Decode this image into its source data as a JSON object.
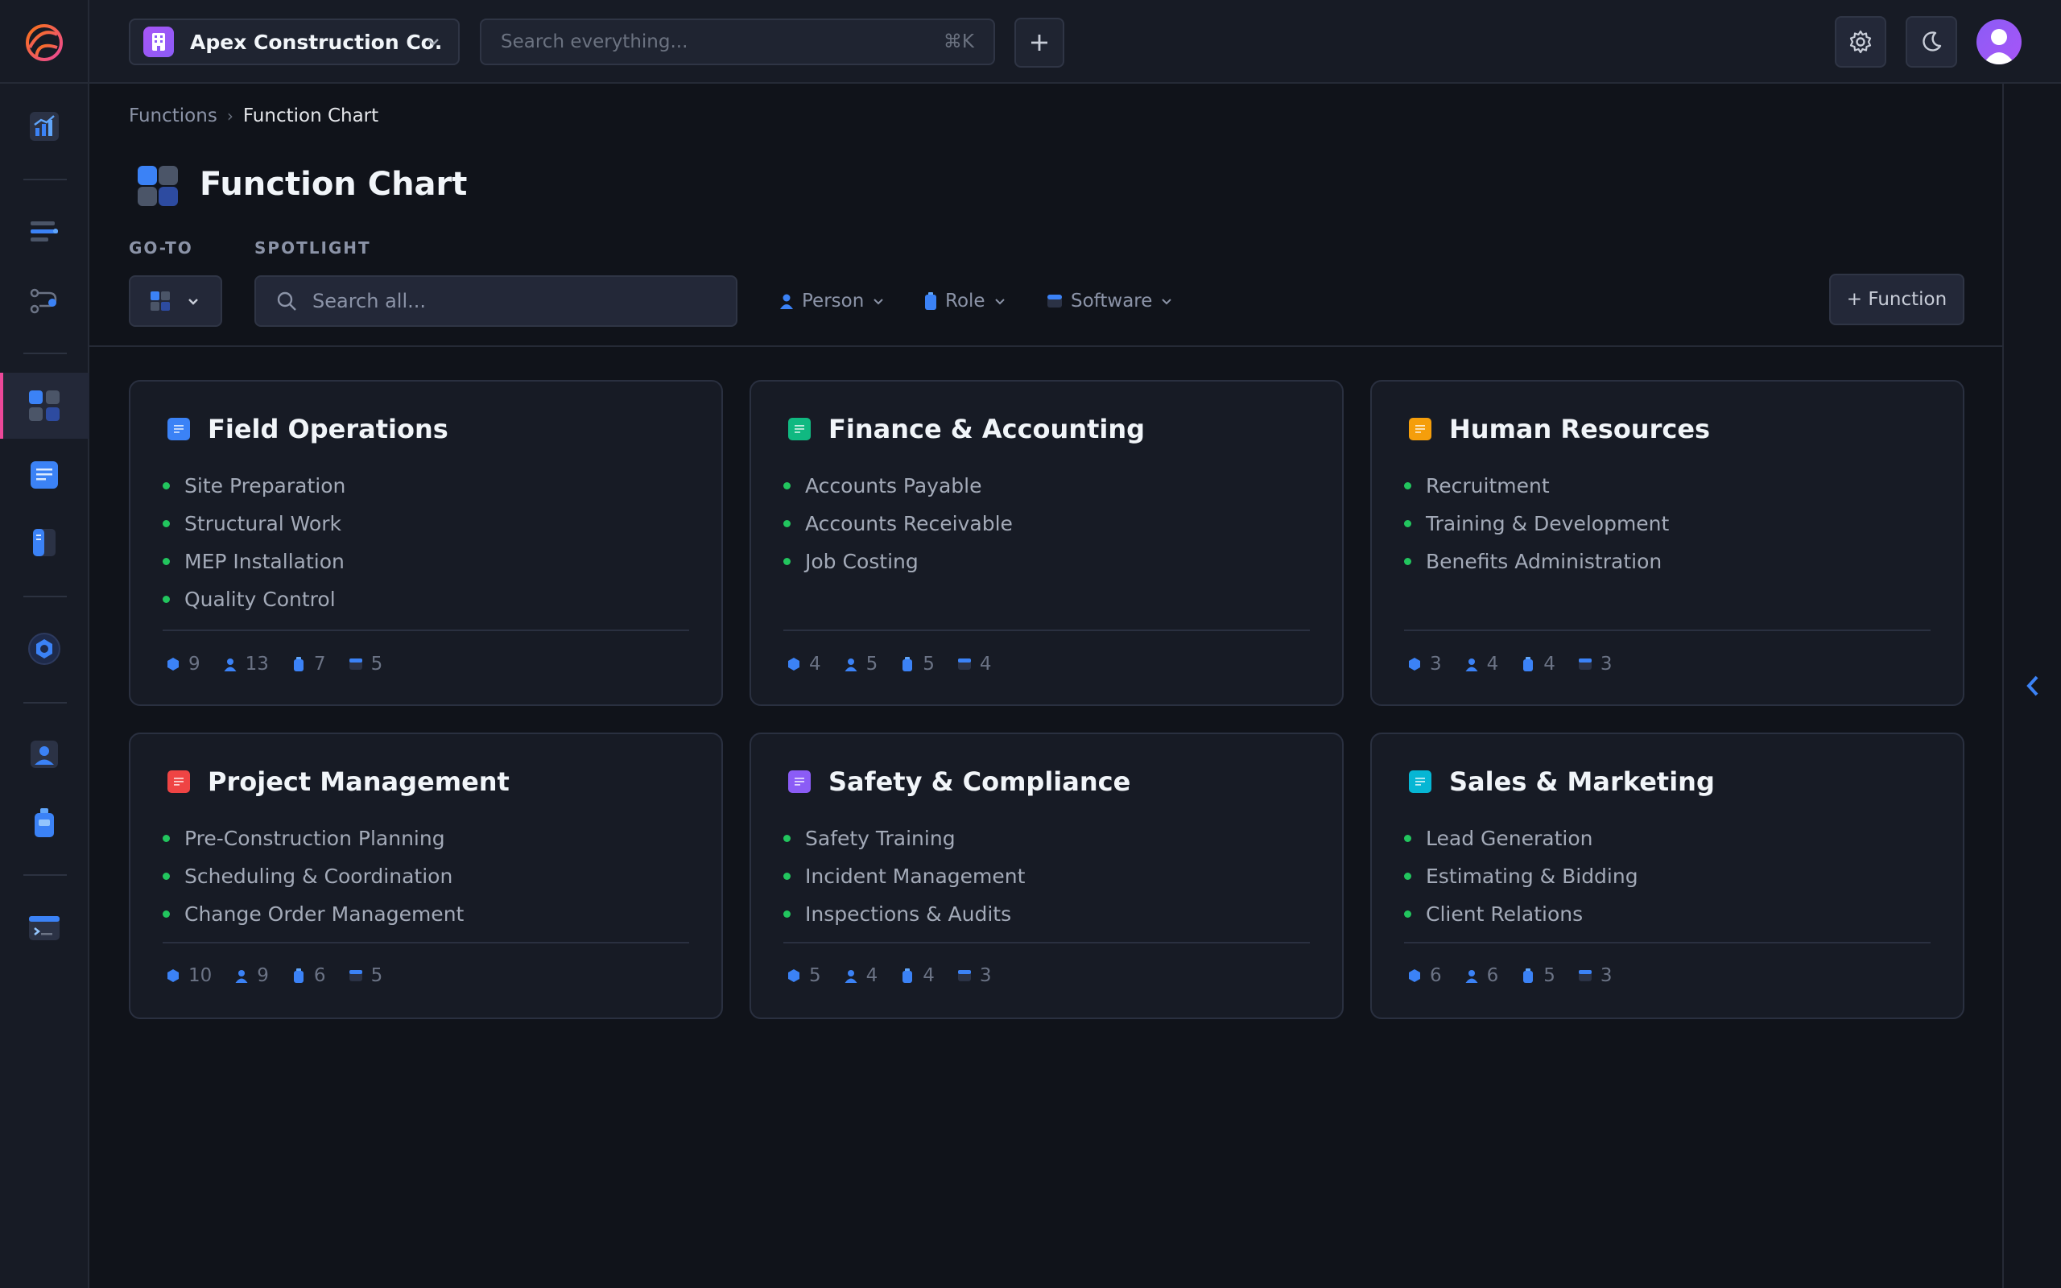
{
  "app": {
    "org_name": "Apex Construction Co."
  },
  "topbar": {
    "search_placeholder": "Search everything...",
    "shortcut": "⌘K"
  },
  "breadcrumb": {
    "parent": "Functions",
    "current": "Function Chart"
  },
  "page": {
    "title": "Function Chart"
  },
  "toolbar": {
    "goto_label": "GO-TO",
    "spotlight_label": "SPOTLIGHT",
    "search_placeholder": "Search all...",
    "filters": {
      "person": "Person",
      "role": "Role",
      "software": "Software"
    },
    "add_button": "+ Function"
  },
  "colors": {
    "accent": "#3b82f6",
    "active_marker": "#ec4899",
    "bullet": "#22c55e",
    "field_ops": "#3b82f6",
    "finance": "#10b981",
    "hr": "#f59e0b",
    "project": "#ef4444",
    "safety": "#8b5cf6",
    "sales": "#06b6d4"
  },
  "sidebar": {
    "items": [
      {
        "icon": "analytics-icon"
      },
      {
        "icon": "list-toggle-icon"
      },
      {
        "icon": "flow-icon"
      },
      {
        "icon": "function-chart-icon",
        "active": true
      },
      {
        "icon": "document-icon"
      },
      {
        "icon": "book-icon"
      },
      {
        "icon": "hexagon-icon"
      },
      {
        "icon": "person-icon"
      },
      {
        "icon": "badge-icon"
      },
      {
        "icon": "terminal-icon"
      }
    ]
  },
  "cards": [
    {
      "title": "Field Operations",
      "color": "#3b82f6",
      "items": [
        "Site Preparation",
        "Structural Work",
        "MEP Installation",
        "Quality Control"
      ],
      "stats": {
        "functions": "9",
        "people": "13",
        "roles": "7",
        "software": "5"
      }
    },
    {
      "title": "Finance & Accounting",
      "color": "#10b981",
      "items": [
        "Accounts Payable",
        "Accounts Receivable",
        "Job Costing"
      ],
      "stats": {
        "functions": "4",
        "people": "5",
        "roles": "5",
        "software": "4"
      }
    },
    {
      "title": "Human Resources",
      "color": "#f59e0b",
      "items": [
        "Recruitment",
        "Training & Development",
        "Benefits Administration"
      ],
      "stats": {
        "functions": "3",
        "people": "4",
        "roles": "4",
        "software": "3"
      }
    },
    {
      "title": "Project Management",
      "color": "#ef4444",
      "items": [
        "Pre-Construction Planning",
        "Scheduling & Coordination",
        "Change Order Management"
      ],
      "stats": {
        "functions": "10",
        "people": "9",
        "roles": "6",
        "software": "5"
      }
    },
    {
      "title": "Safety & Compliance",
      "color": "#8b5cf6",
      "items": [
        "Safety Training",
        "Incident Management",
        "Inspections & Audits"
      ],
      "stats": {
        "functions": "5",
        "people": "4",
        "roles": "4",
        "software": "3"
      }
    },
    {
      "title": "Sales & Marketing",
      "color": "#06b6d4",
      "items": [
        "Lead Generation",
        "Estimating & Bidding",
        "Client Relations"
      ],
      "stats": {
        "functions": "6",
        "people": "6",
        "roles": "5",
        "software": "3"
      }
    }
  ]
}
